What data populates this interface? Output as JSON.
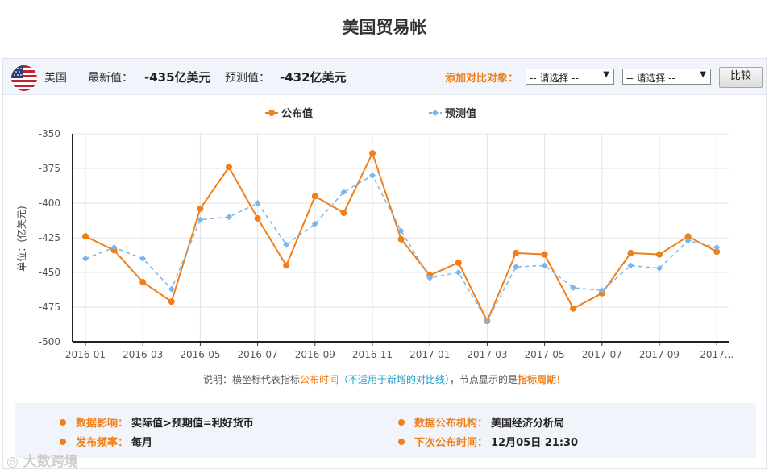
{
  "page": {
    "title": "美国贸易帐"
  },
  "header": {
    "country": "美国",
    "latest_label": "最新值：",
    "latest_value": "-435亿美元",
    "forecast_label": "预测值：",
    "forecast_value": "-432亿美元",
    "compare_label": "添加对比对象：",
    "select1": "-- 请选择 --",
    "select2": "-- 请选择 --",
    "compare_button": "比较",
    "flag_icon": "us-flag-icon"
  },
  "chart_data": {
    "type": "line",
    "title": "",
    "xlabel": "",
    "ylabel": "单位：(亿美元)",
    "ylim": [
      -500,
      -350
    ],
    "yticks": [
      "-350",
      "-375",
      "-400",
      "-425",
      "-450",
      "-475",
      "-500"
    ],
    "categories": [
      "2016-01",
      "2016-02",
      "2016-03",
      "2016-04",
      "2016-05",
      "2016-06",
      "2016-07",
      "2016-08",
      "2016-09",
      "2016-10",
      "2016-11",
      "2016-12",
      "2017-01",
      "2017-02",
      "2017-03",
      "2017-04",
      "2017-05",
      "2017-06",
      "2017-07",
      "2017-08",
      "2017-09",
      "2017-10"
    ],
    "xtick_labels": [
      "2016-01",
      "2016-03",
      "2016-05",
      "2016-07",
      "2016-09",
      "2016-11",
      "2017-01",
      "2017-03",
      "2017-05",
      "2017-07",
      "2017-09",
      "2017..."
    ],
    "legend_position": "top-center",
    "grid": true,
    "series": [
      {
        "name": "公布值",
        "color": "#f07f19",
        "style": "solid",
        "marker": "circle",
        "values": [
          -424,
          -434,
          -457,
          -471,
          -404,
          -374,
          -411,
          -445,
          -395,
          -407,
          -364,
          -426,
          -452,
          -443,
          -485,
          -436,
          -437,
          -476,
          -465,
          -436,
          -437,
          -424,
          -435
        ]
      },
      {
        "name": "预测值",
        "color": "#7cb5ec",
        "style": "dashed",
        "marker": "diamond",
        "values": [
          -440,
          -432,
          -440,
          -462,
          -412,
          -410,
          -400,
          -430,
          -415,
          -392,
          -380,
          -420,
          -454,
          -450,
          -485,
          -446,
          -445,
          -461,
          -463,
          -445,
          -447,
          -427,
          -432
        ]
      }
    ]
  },
  "note": {
    "prefix": "说明：横坐标代表指标",
    "part1": "公布时间",
    "part2": "（不适用于新增的对比线）",
    "part3": "，节点显示的是",
    "part4": "指标周期",
    "part5": "！"
  },
  "info": {
    "impact_label": "数据影响：",
    "impact_value": "实际值>预期值=利好货币",
    "agency_label": "数据公布机构：",
    "agency_value": "美国经济分析局",
    "freq_label": "发布频率：",
    "freq_value": "每月",
    "next_label": "下次公布时间：",
    "next_value": "12月05日 21:30"
  },
  "watermark": "大数跨境"
}
